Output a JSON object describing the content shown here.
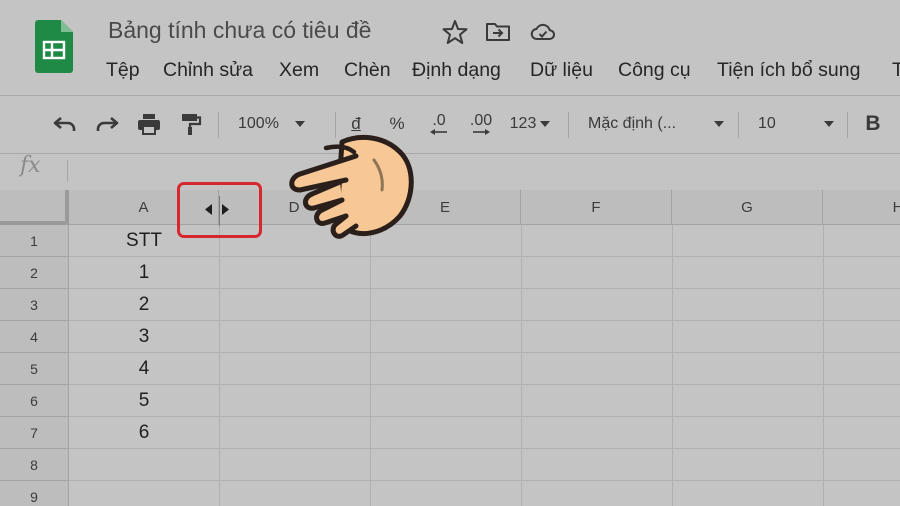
{
  "header": {
    "title": "Bảng tính chưa có tiêu đề",
    "icons": [
      "star-icon",
      "move-to-folder-icon",
      "cloud-status-icon"
    ]
  },
  "menu": {
    "items": [
      {
        "label": "Tệp"
      },
      {
        "label": "Chỉnh sửa"
      },
      {
        "label": "Xem"
      },
      {
        "label": "Chèn"
      },
      {
        "label": "Định dạng"
      },
      {
        "label": "Dữ liệu"
      },
      {
        "label": "Công cụ"
      },
      {
        "label": "Tiện ích bổ sung"
      },
      {
        "label": "T"
      }
    ]
  },
  "toolbar": {
    "zoom": "100%",
    "currency": "đ",
    "percent": "%",
    "decrease_decimal": ".0",
    "increase_decimal": ".00",
    "more_formats": "123",
    "font": "Mặc định (...",
    "font_size": "10",
    "bold": "B"
  },
  "formula_bar": {
    "fx_label": "fx"
  },
  "grid": {
    "column_headers": [
      "A",
      "D",
      "E",
      "F",
      "G",
      "H"
    ],
    "row_headers": [
      "1",
      "2",
      "3",
      "4",
      "5",
      "6",
      "7",
      "8",
      "9"
    ],
    "column_a_values": [
      "STT",
      "1",
      "2",
      "3",
      "4",
      "5",
      "6",
      "",
      ""
    ]
  },
  "colors": {
    "background": "#c4c4c4",
    "logo_green": "#1f8a45",
    "highlight_red": "#d6272f",
    "hand_fill": "#f7c896",
    "hand_outline": "#2a1f1a"
  }
}
